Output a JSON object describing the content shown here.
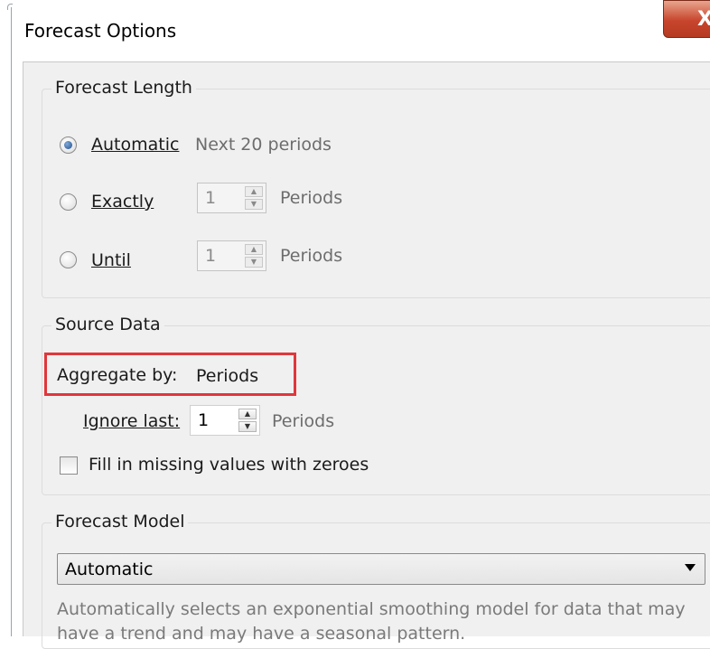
{
  "window": {
    "title": "Forecast Options",
    "close_label": "X"
  },
  "forecast_length": {
    "group_label": "Forecast Length",
    "automatic": {
      "label": "Automatic",
      "hint": "Next 20 periods",
      "selected": true
    },
    "exactly": {
      "label": "Exactly",
      "value": "1",
      "unit": "Periods",
      "selected": false
    },
    "until": {
      "label": "Until",
      "value": "1",
      "unit": "Periods",
      "selected": false
    }
  },
  "source_data": {
    "group_label": "Source Data",
    "aggregate_label": "Aggregate by:",
    "aggregate_value": "Periods",
    "ignore_label": "Ignore last:",
    "ignore_value": "1",
    "ignore_unit": "Periods",
    "fill_missing_label": "Fill in missing values with zeroes",
    "fill_missing_checked": false
  },
  "forecast_model": {
    "group_label": "Forecast Model",
    "selected": "Automatic",
    "description": "Automatically selects an exponential smoothing model for data that may have a trend and may have a seasonal pattern."
  },
  "colors": {
    "highlight": "#e0373b",
    "dialog_bg": "#f0f0f0",
    "close_button": "#c8452c"
  }
}
